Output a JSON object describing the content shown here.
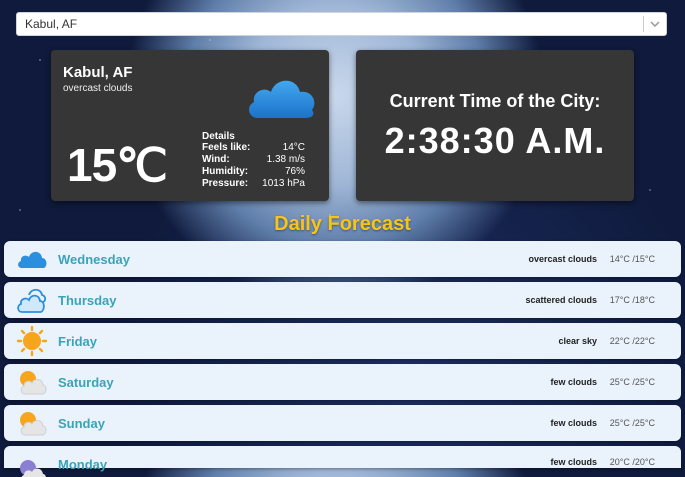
{
  "search": {
    "selected": "Kabul, AF"
  },
  "current": {
    "city": "Kabul, AF",
    "description": "overcast clouds",
    "temperature": "15℃",
    "icon": "cloud-icon",
    "details": {
      "title": "Details",
      "feels_like_label": "Feels like:",
      "feels_like": "14°C",
      "wind_label": "Wind:",
      "wind": "1.38 m/s",
      "humidity_label": "Humidity:",
      "humidity": "76%",
      "pressure_label": "Pressure:",
      "pressure": "1013 hPa"
    }
  },
  "time": {
    "label": "Current Time of the City:",
    "value": "2:38:30 A.M."
  },
  "forecast": {
    "title": "Daily Forecast",
    "days": [
      {
        "day": "Wednesday",
        "condition": "overcast clouds",
        "temps": "14°C /15°C",
        "icon": "overcast-cloud-icon"
      },
      {
        "day": "Thursday",
        "condition": "scattered clouds",
        "temps": "17°C /18°C",
        "icon": "scattered-cloud-icon"
      },
      {
        "day": "Friday",
        "condition": "clear sky",
        "temps": "22°C /22°C",
        "icon": "sun-icon"
      },
      {
        "day": "Saturday",
        "condition": "few clouds",
        "temps": "25°C /25°C",
        "icon": "partly-cloudy-icon"
      },
      {
        "day": "Sunday",
        "condition": "few clouds",
        "temps": "25°C /25°C",
        "icon": "partly-cloudy-icon"
      },
      {
        "day": "Monday",
        "condition": "few clouds",
        "temps": "20°C /20°C",
        "icon": "partly-cloudy-icon"
      }
    ]
  }
}
